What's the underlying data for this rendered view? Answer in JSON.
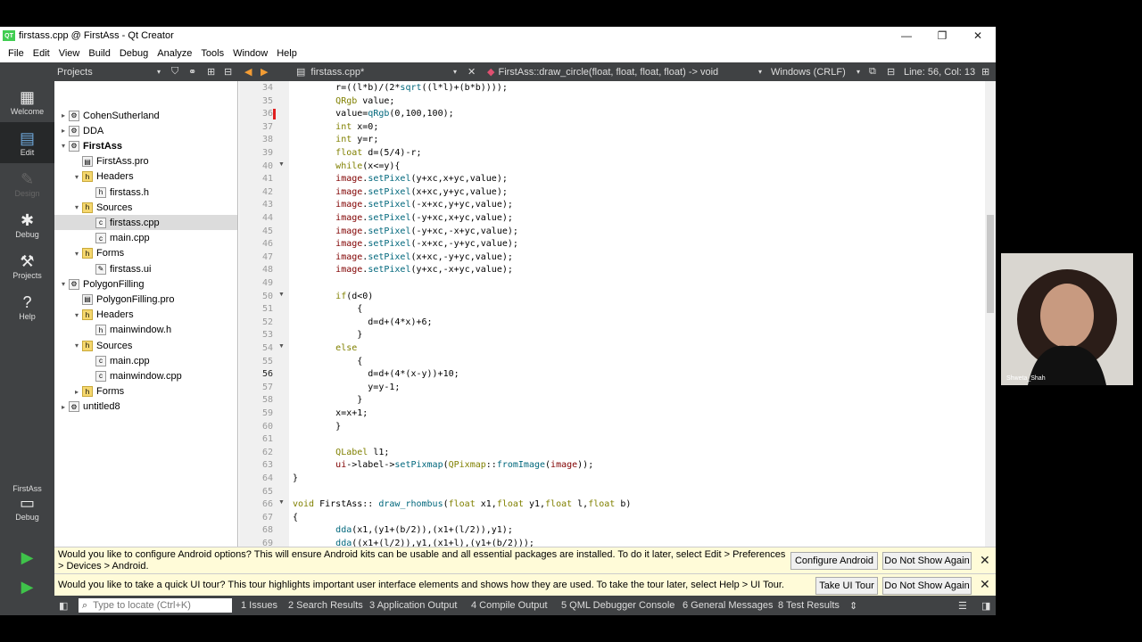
{
  "window": {
    "title": "firstass.cpp @ FirstAss - Qt Creator",
    "logo": "QT"
  },
  "menu": [
    "File",
    "Edit",
    "View",
    "Build",
    "Debug",
    "Analyze",
    "Tools",
    "Window",
    "Help"
  ],
  "toolbar": {
    "projects_label": "Projects",
    "file_tab": "firstass.cpp*",
    "function": "FirstAss::draw_circle(float, float, float, float) -> void",
    "line_ending": "Windows (CRLF)",
    "position": "Line: 56, Col: 13"
  },
  "modes": [
    {
      "label": "Welcome"
    },
    {
      "label": "Edit"
    },
    {
      "label": "Design"
    },
    {
      "label": "Debug"
    },
    {
      "label": "Projects"
    },
    {
      "label": "Help"
    }
  ],
  "kit": {
    "project": "FirstAss",
    "config": "Debug"
  },
  "tree": [
    {
      "label": "CohenSutherland",
      "depth": 0,
      "arrow": "▸",
      "icon": "project-icon"
    },
    {
      "label": "DDA",
      "depth": 0,
      "arrow": "▸",
      "icon": "project-icon"
    },
    {
      "label": "FirstAss",
      "depth": 0,
      "arrow": "▾",
      "icon": "project-icon",
      "bold": true
    },
    {
      "label": "FirstAss.pro",
      "depth": 1,
      "arrow": "",
      "icon": "pro-file-icon"
    },
    {
      "label": "Headers",
      "depth": 1,
      "arrow": "▾",
      "icon": "folder-icon"
    },
    {
      "label": "firstass.h",
      "depth": 2,
      "arrow": "",
      "icon": "header-file-icon"
    },
    {
      "label": "Sources",
      "depth": 1,
      "arrow": "▾",
      "icon": "folder-icon"
    },
    {
      "label": "firstass.cpp",
      "depth": 2,
      "arrow": "",
      "icon": "cpp-file-icon",
      "selected": true
    },
    {
      "label": "main.cpp",
      "depth": 2,
      "arrow": "",
      "icon": "cpp-file-icon"
    },
    {
      "label": "Forms",
      "depth": 1,
      "arrow": "▾",
      "icon": "folder-icon"
    },
    {
      "label": "firstass.ui",
      "depth": 2,
      "arrow": "",
      "icon": "ui-file-icon"
    },
    {
      "label": "PolygonFilling",
      "depth": 0,
      "arrow": "▾",
      "icon": "project-icon"
    },
    {
      "label": "PolygonFilling.pro",
      "depth": 1,
      "arrow": "",
      "icon": "pro-file-icon"
    },
    {
      "label": "Headers",
      "depth": 1,
      "arrow": "▾",
      "icon": "folder-icon"
    },
    {
      "label": "mainwindow.h",
      "depth": 2,
      "arrow": "",
      "icon": "header-file-icon"
    },
    {
      "label": "Sources",
      "depth": 1,
      "arrow": "▾",
      "icon": "folder-icon"
    },
    {
      "label": "main.cpp",
      "depth": 2,
      "arrow": "",
      "icon": "cpp-file-icon"
    },
    {
      "label": "mainwindow.cpp",
      "depth": 2,
      "arrow": "",
      "icon": "cpp-file-icon"
    },
    {
      "label": "Forms",
      "depth": 1,
      "arrow": "▸",
      "icon": "folder-icon"
    },
    {
      "label": "untitled8",
      "depth": 0,
      "arrow": "▸",
      "icon": "project-icon"
    }
  ],
  "code": [
    {
      "n": "34",
      "t": "        r=((l*b)/(2*sqrt((l*l)+(b*b))));"
    },
    {
      "n": "35",
      "t": "        QRgb value;"
    },
    {
      "n": "36",
      "t": "        value=qRgb(0,100,100);"
    },
    {
      "n": "37",
      "t": "        int x=0;"
    },
    {
      "n": "38",
      "t": "        int y=r;"
    },
    {
      "n": "39",
      "t": "        float d=(5/4)-r;"
    },
    {
      "n": "40",
      "t": "        while(x<=y){",
      "fold": true
    },
    {
      "n": "41",
      "t": "        image.setPixel(y+xc,x+yc,value);"
    },
    {
      "n": "42",
      "t": "        image.setPixel(x+xc,y+yc,value);"
    },
    {
      "n": "43",
      "t": "        image.setPixel(-x+xc,y+yc,value);"
    },
    {
      "n": "44",
      "t": "        image.setPixel(-y+xc,x+yc,value);"
    },
    {
      "n": "45",
      "t": "        image.setPixel(-y+xc,-x+yc,value);"
    },
    {
      "n": "46",
      "t": "        image.setPixel(-x+xc,-y+yc,value);"
    },
    {
      "n": "47",
      "t": "        image.setPixel(x+xc,-y+yc,value);"
    },
    {
      "n": "48",
      "t": "        image.setPixel(y+xc,-x+yc,value);"
    },
    {
      "n": "49",
      "t": ""
    },
    {
      "n": "50",
      "t": "        if(d<0)",
      "fold": true
    },
    {
      "n": "51",
      "t": "            {"
    },
    {
      "n": "52",
      "t": "              d=d+(4*x)+6;"
    },
    {
      "n": "53",
      "t": "            }"
    },
    {
      "n": "54",
      "t": "        else",
      "fold": true
    },
    {
      "n": "55",
      "t": "            {"
    },
    {
      "n": "56",
      "t": "              d=d+(4*(x-y))+10;",
      "current": true
    },
    {
      "n": "57",
      "t": "              y=y-1;"
    },
    {
      "n": "58",
      "t": "            }"
    },
    {
      "n": "59",
      "t": "        x=x+1;"
    },
    {
      "n": "60",
      "t": "        }"
    },
    {
      "n": "61",
      "t": ""
    },
    {
      "n": "62",
      "t": "        QLabel l1;"
    },
    {
      "n": "63",
      "t": "        ui->label->setPixmap(QPixmap::fromImage(image));"
    },
    {
      "n": "64",
      "t": "}"
    },
    {
      "n": "65",
      "t": ""
    },
    {
      "n": "66",
      "t": "void FirstAss:: draw_rhombus(float x1,float y1,float l,float b)",
      "fold": true
    },
    {
      "n": "67",
      "t": "{"
    },
    {
      "n": "68",
      "t": "        dda(x1,(y1+(b/2)),(x1+(l/2)),y1);"
    },
    {
      "n": "69",
      "t": "        dda((x1+(l/2)),y1,(x1+l),(y1+(b/2)));"
    }
  ],
  "infobars": [
    {
      "text": "Would you like to configure Android options? This will ensure Android kits can be usable and all essential packages are installed. To do it later, select Edit > Preferences > Devices > Android.",
      "action": "Configure Android",
      "dismiss": "Do Not Show Again"
    },
    {
      "text": "Would you like to take a quick UI tour? This tour highlights important user interface elements and shows how they are used. To take the tour later, select Help > UI Tour.",
      "action": "Take UI Tour",
      "dismiss": "Do Not Show Again"
    }
  ],
  "statusbar": {
    "locate_placeholder": "Type to locate (Ctrl+K)",
    "panes": [
      "1  Issues",
      "2  Search Results",
      "3  Application Output",
      "4  Compile Output",
      "5  QML Debugger Console",
      "6  General Messages",
      "8  Test Results"
    ]
  },
  "webcam": {
    "name": "Shweta_Shah"
  },
  "colors": {
    "keyword": "#808000",
    "type": "#808000",
    "func": "#00677c",
    "number": "#000080",
    "accent": "#41cd52",
    "dark": "#404244"
  }
}
